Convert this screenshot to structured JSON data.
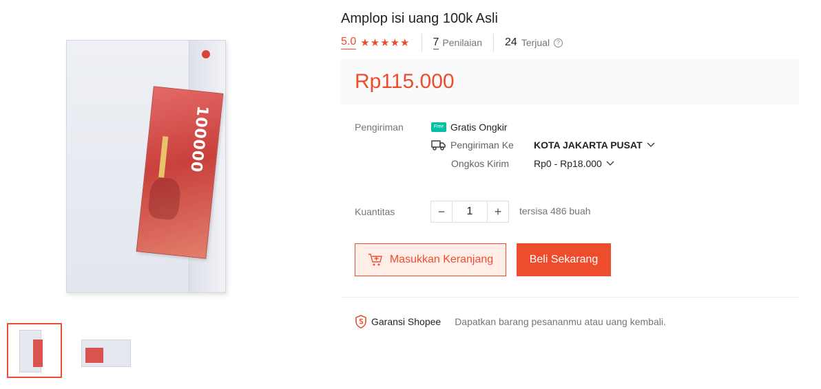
{
  "product": {
    "title": "Amplop isi uang 100k Asli",
    "rating": "5.0",
    "stars": "★★★★★",
    "review_count": "7",
    "review_label": "Penilaian",
    "sold_count": "24",
    "sold_label": "Terjual",
    "help_glyph": "?",
    "price": "Rp115.000"
  },
  "gallery": {
    "banknote_text": "100000",
    "thumbnails": [
      "thumbnail-1",
      "thumbnail-2"
    ]
  },
  "shipping": {
    "label": "Pengiriman",
    "free_badge": "Free",
    "free_text": "Gratis Ongkir",
    "ship_to_label": "Pengiriman Ke",
    "ship_to_value": "KOTA JAKARTA PUSAT",
    "cost_label": "Ongkos Kirim",
    "cost_value": "Rp0 - Rp18.000"
  },
  "quantity": {
    "label": "Kuantitas",
    "minus": "−",
    "value": "1",
    "plus": "+",
    "stock_text": "tersisa 486 buah"
  },
  "actions": {
    "cart_label": "Masukkan Keranjang",
    "buy_label": "Beli Sekarang"
  },
  "guarantee": {
    "title": "Garansi Shopee",
    "description": "Dapatkan barang pesananmu atau uang kembali."
  },
  "colors": {
    "accent": "#ee4d2d",
    "free_shipping": "#00bfa5"
  }
}
